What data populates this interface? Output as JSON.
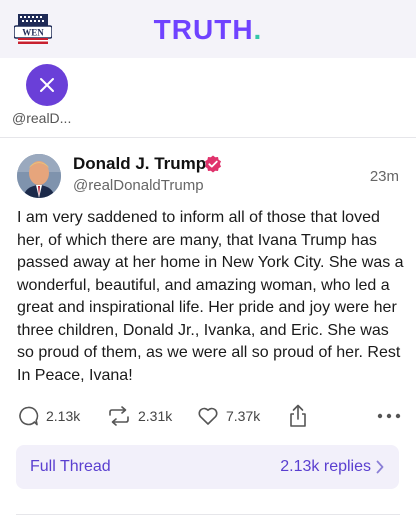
{
  "header": {
    "badge_text": "WEN",
    "brand_main": "TRUTH",
    "brand_dot": ".",
    "brand_color": "#6f42ff",
    "dot_color": "#35c7a8"
  },
  "story": {
    "handle": "@realD...",
    "avatar_icon": "close-icon",
    "avatar_color": "#6a3fd8"
  },
  "post": {
    "author_name": "Donald J. Trump",
    "verified_icon": "verified-badge-icon",
    "verified_color": "#e0336c",
    "handle": "@realDonaldTrump",
    "time": "23m",
    "body": "I am very saddened to inform all of those that loved her, of which there are many, that Ivana Trump has passed away at her home in New York City. She was a wonderful, beautiful, and amazing woman, who led a great and inspirational life. Her pride and joy were her three children, Donald Jr., Ivanka, and Eric. She was so proud of them, as we were all so proud of her. Rest In Peace, Ivana!",
    "actions": {
      "replies": "2.13k",
      "retruths": "2.31k",
      "likes": "7.37k"
    }
  },
  "thread": {
    "label": "Full Thread",
    "replies": "2.13k replies",
    "accent": "#5a3fd0"
  }
}
